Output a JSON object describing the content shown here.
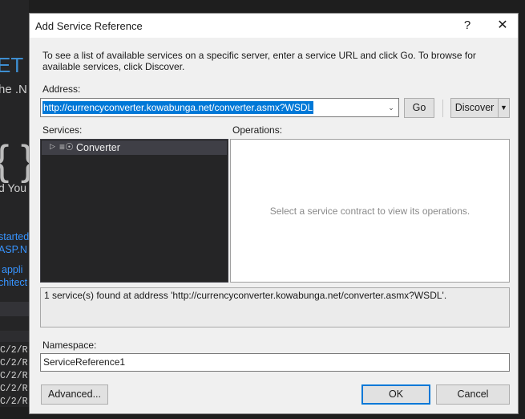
{
  "background": {
    "fragment_large": "ET",
    "fragment_ne": "he .N",
    "fragment_brace": "{ }",
    "fragment_you": "d You",
    "links": [
      "started",
      "ASP.N",
      "appli",
      "chitect"
    ],
    "code_lines": [
      "C/2/R",
      "C/2/R",
      "C/2/R",
      "C/2/R",
      "C/2/R",
      "C/2/R"
    ]
  },
  "dialog": {
    "title": "Add Service Reference",
    "help_label": "?",
    "close_label": "✕",
    "intro": "To see a list of available services on a specific server, enter a service URL and click Go. To browse for available services, click Discover.",
    "address": {
      "label": "Address:",
      "value": "http://currencyconverter.kowabunga.net/converter.asmx?WSDL"
    },
    "go_label": "Go",
    "discover_label": "Discover",
    "services": {
      "label": "Services:",
      "items": [
        {
          "label": "Converter",
          "icon": "globe-service-icon"
        }
      ]
    },
    "operations": {
      "label": "Operations:",
      "empty_text": "Select a service contract to view its operations."
    },
    "status_text": "1 service(s) found at address 'http://currencyconverter.kowabunga.net/converter.asmx?WSDL'.",
    "namespace": {
      "label": "Namespace:",
      "value": "ServiceReference1"
    },
    "advanced_label": "Advanced...",
    "ok_label": "OK",
    "cancel_label": "Cancel"
  },
  "colors": {
    "accent": "#0078d7",
    "dialog_bg": "#f0f0f0",
    "tree_bg": "#252526",
    "tree_selected": "#3f3f46",
    "link": "#3794ff"
  }
}
